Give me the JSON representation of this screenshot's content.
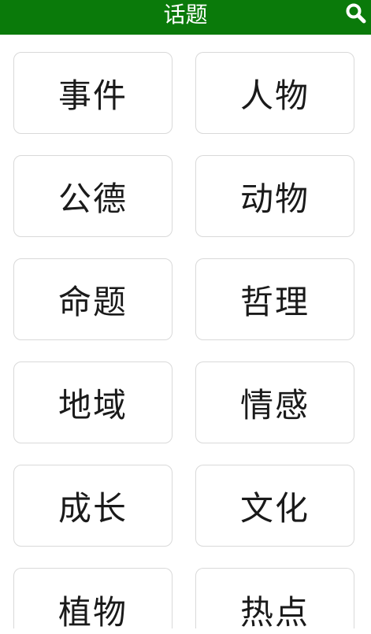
{
  "header": {
    "title": "话题",
    "search_icon": "search-icon",
    "background_color": "#0a7a0a"
  },
  "topics": [
    {
      "label": "事件"
    },
    {
      "label": "人物"
    },
    {
      "label": "公德"
    },
    {
      "label": "动物"
    },
    {
      "label": "命题"
    },
    {
      "label": "哲理"
    },
    {
      "label": "地域"
    },
    {
      "label": "情感"
    },
    {
      "label": "成长"
    },
    {
      "label": "文化"
    },
    {
      "label": "植物"
    },
    {
      "label": "热点"
    }
  ]
}
